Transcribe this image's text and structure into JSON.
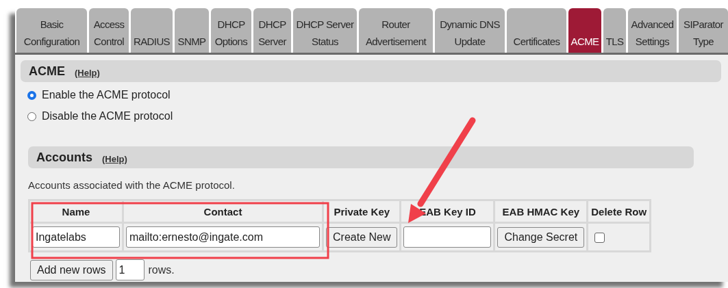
{
  "tabs": [
    {
      "label": "Basic\nConfiguration",
      "selected": false
    },
    {
      "label": "Access\nControl",
      "selected": false
    },
    {
      "label": "RADIUS",
      "selected": false
    },
    {
      "label": "SNMP",
      "selected": false
    },
    {
      "label": "DHCP\nOptions",
      "selected": false
    },
    {
      "label": "DHCP\nServer",
      "selected": false
    },
    {
      "label": "DHCP Server\nStatus",
      "selected": false
    },
    {
      "label": "Router\nAdvertisement",
      "selected": false
    },
    {
      "label": "Dynamic DNS\nUpdate",
      "selected": false
    },
    {
      "label": "Certificates",
      "selected": false
    },
    {
      "label": "ACME",
      "selected": true
    },
    {
      "label": "TLS",
      "selected": false
    },
    {
      "label": "Advanced\nSettings",
      "selected": false
    },
    {
      "label": "SIParator\nType",
      "selected": false
    }
  ],
  "acme": {
    "title": "ACME",
    "help": "(Help)",
    "options": [
      {
        "label": "Enable the ACME protocol",
        "selected": true
      },
      {
        "label": "Disable the ACME protocol",
        "selected": false
      }
    ]
  },
  "accounts": {
    "title": "Accounts",
    "help": "(Help)",
    "description": "Accounts associated with the ACME protocol.",
    "table": {
      "columns": [
        "Name",
        "Contact",
        "Private Key",
        "EAB Key ID",
        "EAB HMAC Key",
        "Delete Row"
      ],
      "rows": [
        {
          "cells": [
            {
              "kind": "field",
              "value": "Ingatelabs"
            },
            {
              "kind": "field",
              "value": "mailto:ernesto@ingate.com"
            },
            {
              "kind": "button",
              "label": "Create New"
            },
            {
              "kind": "field"
            },
            {
              "kind": "button",
              "label": "Change Secret"
            },
            {
              "kind": "checkbox",
              "checked": false
            }
          ]
        }
      ]
    },
    "add_rows": {
      "button": "Add new rows",
      "count": "1",
      "suffix": "rows."
    }
  }
}
